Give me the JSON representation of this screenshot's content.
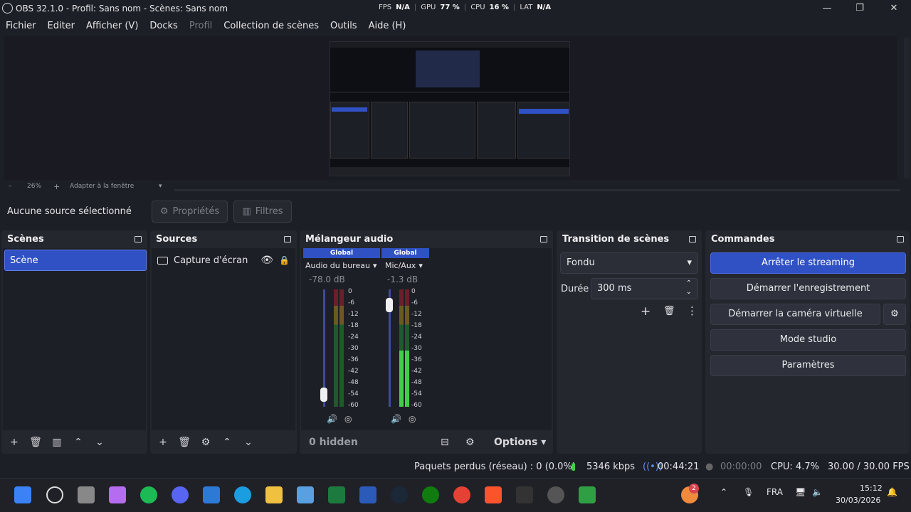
{
  "window": {
    "title": "OBS 32.1.0 - Profil: Sans nom - Scènes: Sans nom",
    "stats": {
      "fps_label": "FPS",
      "fps": "N/A",
      "gpu_label": "GPU",
      "gpu": "77 %",
      "cpu_label": "CPU",
      "cpu": "16 %",
      "lat_label": "LAT",
      "lat": "N/A"
    },
    "minimize": "—",
    "maximize": "❐",
    "close": "✕"
  },
  "menu": [
    "Fichier",
    "Editer",
    "Afficher (V)",
    "Docks",
    "Profil",
    "Collection de scènes",
    "Outils",
    "Aide (H)"
  ],
  "zoom": {
    "minus": "–",
    "value": "26%",
    "plus": "+",
    "fit": "Adapter à la fenêtre"
  },
  "source_bar": {
    "selection": "Aucune source sélectionné",
    "properties": "Propriétés",
    "filters": "Filtres"
  },
  "scenes": {
    "title": "Scènes",
    "items": [
      "Scène"
    ]
  },
  "sources": {
    "title": "Sources",
    "items": [
      {
        "name": "Capture d'écran"
      }
    ]
  },
  "mixer": {
    "title": "Mélangeur audio",
    "channels": [
      {
        "header": "Global",
        "name": "Audio du bureau",
        "db": "-78.0 dB",
        "level": 0.05,
        "color": "#3f4a9a"
      },
      {
        "header": "Global",
        "name": "Mic/Aux",
        "db": "-1.3 dB",
        "level": 0.95,
        "color": "#3f4a9a"
      }
    ],
    "scale": [
      "0",
      "-6",
      "-12",
      "-18",
      "-24",
      "-30",
      "-36",
      "-42",
      "-48",
      "-54",
      "-60"
    ],
    "hidden": "0 hidden",
    "options": "Options"
  },
  "transitions": {
    "title": "Transition de scènes",
    "selected": "Fondu",
    "duration_label": "Durée",
    "duration": "300 ms"
  },
  "controls": {
    "title": "Commandes",
    "buttons": [
      "Arrêter le streaming",
      "Démarrer l'enregistrement",
      "Démarrer la caméra virtuelle",
      "Mode studio",
      "Paramètres"
    ]
  },
  "status": {
    "dropped": "Paquets perdus (réseau) : 0 (0.0%)",
    "bitrate": "5346 kbps",
    "stream_time": "00:44:21",
    "rec_time": "00:00:00",
    "cpu": "CPU: 4.7%",
    "fps": "30.00 / 30.00 FPS"
  },
  "taskbar": {
    "lang": "FRA",
    "time": "15:12",
    "date": "30/03/2026",
    "badge": "2"
  },
  "colors": {
    "accent": "#2f51c4",
    "bg": "#1d1f26",
    "panel": "#25272f"
  }
}
